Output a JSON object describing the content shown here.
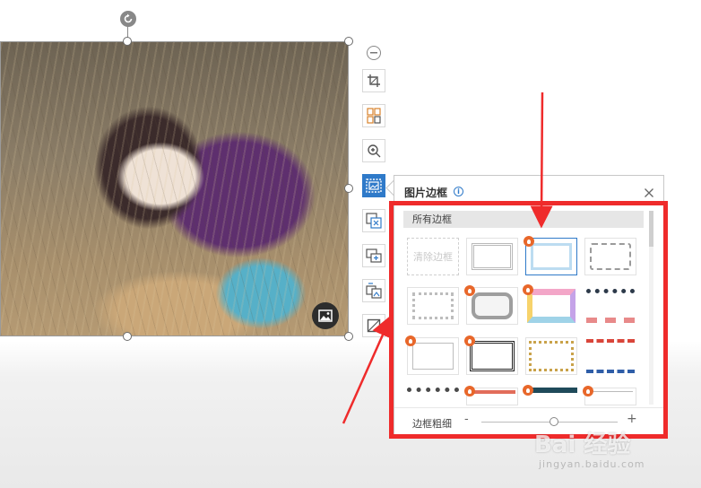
{
  "toolbar": {
    "tools": [
      {
        "name": "crop-icon"
      },
      {
        "name": "split-image-icon"
      },
      {
        "name": "zoom-in-icon"
      },
      {
        "name": "picture-border-icon"
      },
      {
        "name": "replace-image-icon"
      },
      {
        "name": "multi-image-icon"
      },
      {
        "name": "image-to-text-icon"
      },
      {
        "name": "outline-icon"
      }
    ]
  },
  "panel": {
    "title": "图片边框",
    "section_label": "所有边框",
    "clear_label": "清除边框",
    "thickness_label": "边框粗细",
    "dec_label": "-",
    "inc_label": "+",
    "thickness_level": 0.53
  },
  "watermark": {
    "logo_text": "Bai 经验",
    "url": "jingyan.baidu.com"
  },
  "colors": {
    "accent": "#2f7ac9",
    "highlight_red": "#ef2b2b",
    "badge_orange": "#e8672a"
  }
}
